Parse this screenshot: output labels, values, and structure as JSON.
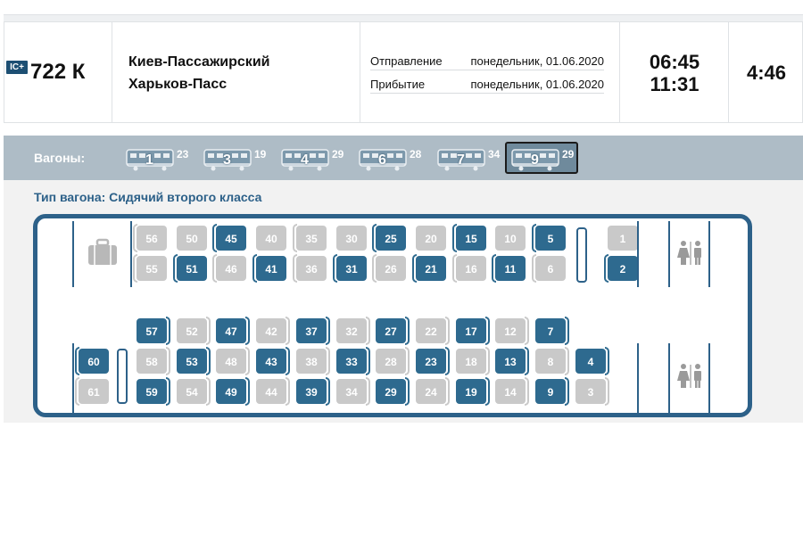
{
  "train": {
    "badge": "IC+",
    "number": "722 К",
    "route_from": "Киев-Пассажирский",
    "route_to": "Харьков-Пасс",
    "departure_label": "Отправление",
    "departure_date": "понедельник, 01.06.2020",
    "arrival_label": "Прибытие",
    "arrival_date": "понедельник, 01.06.2020",
    "departure_time": "06:45",
    "arrival_time": "11:31",
    "duration": "4:46"
  },
  "wagons": {
    "label": "Вагоны:",
    "items": [
      {
        "number": "1",
        "seats": "23",
        "selected": false
      },
      {
        "number": "3",
        "seats": "19",
        "selected": false
      },
      {
        "number": "4",
        "seats": "29",
        "selected": false
      },
      {
        "number": "6",
        "seats": "28",
        "selected": false
      },
      {
        "number": "7",
        "seats": "34",
        "selected": false
      },
      {
        "number": "9",
        "seats": "29",
        "selected": true
      }
    ]
  },
  "car": {
    "type_label": "Тип вагона: Сидячий второго класса",
    "colors": {
      "frame": "#2d6189",
      "free_seat": "#2e6a8f",
      "busy_seat": "#c9c9c9"
    },
    "icons": [
      "luggage-icon",
      "wc-icon",
      "wc-icon"
    ],
    "upper_block": {
      "row_top": [
        {
          "n": "56",
          "free": false
        },
        {
          "n": "50",
          "free": false
        },
        {
          "n": "45",
          "free": true
        },
        {
          "n": "40",
          "free": false
        },
        {
          "n": "35",
          "free": false
        },
        {
          "n": "30",
          "free": false
        },
        {
          "n": "25",
          "free": true
        },
        {
          "n": "20",
          "free": false
        },
        {
          "n": "15",
          "free": true
        },
        {
          "n": "10",
          "free": false
        },
        {
          "n": "5",
          "free": true
        },
        {
          "n": "1",
          "free": false
        }
      ],
      "row_bottom": [
        {
          "n": "55",
          "free": false
        },
        {
          "n": "51",
          "free": true
        },
        {
          "n": "46",
          "free": false
        },
        {
          "n": "41",
          "free": true
        },
        {
          "n": "36",
          "free": false
        },
        {
          "n": "31",
          "free": true
        },
        {
          "n": "26",
          "free": false
        },
        {
          "n": "21",
          "free": true
        },
        {
          "n": "16",
          "free": false
        },
        {
          "n": "11",
          "free": true
        },
        {
          "n": "6",
          "free": false
        },
        {
          "n": "2",
          "free": true
        }
      ]
    },
    "lower_block": {
      "row_a": [
        {
          "n": "57",
          "free": true
        },
        {
          "n": "52",
          "free": false
        },
        {
          "n": "47",
          "free": true
        },
        {
          "n": "42",
          "free": false
        },
        {
          "n": "37",
          "free": true
        },
        {
          "n": "32",
          "free": false
        },
        {
          "n": "27",
          "free": true
        },
        {
          "n": "22",
          "free": false
        },
        {
          "n": "17",
          "free": true
        },
        {
          "n": "12",
          "free": false
        },
        {
          "n": "7",
          "free": true
        }
      ],
      "row_b": [
        {
          "n": "60",
          "free": true
        },
        {
          "n": "58",
          "free": false
        },
        {
          "n": "53",
          "free": true
        },
        {
          "n": "48",
          "free": false
        },
        {
          "n": "43",
          "free": true
        },
        {
          "n": "38",
          "free": false
        },
        {
          "n": "33",
          "free": true
        },
        {
          "n": "28",
          "free": false
        },
        {
          "n": "23",
          "free": true
        },
        {
          "n": "18",
          "free": false
        },
        {
          "n": "13",
          "free": true
        },
        {
          "n": "8",
          "free": false
        },
        {
          "n": "4",
          "free": true
        }
      ],
      "row_c": [
        {
          "n": "61",
          "free": false
        },
        {
          "n": "59",
          "free": true
        },
        {
          "n": "54",
          "free": false
        },
        {
          "n": "49",
          "free": true
        },
        {
          "n": "44",
          "free": false
        },
        {
          "n": "39",
          "free": true
        },
        {
          "n": "34",
          "free": false
        },
        {
          "n": "29",
          "free": true
        },
        {
          "n": "24",
          "free": false
        },
        {
          "n": "19",
          "free": true
        },
        {
          "n": "14",
          "free": false
        },
        {
          "n": "9",
          "free": true
        },
        {
          "n": "3",
          "free": false
        }
      ]
    }
  }
}
